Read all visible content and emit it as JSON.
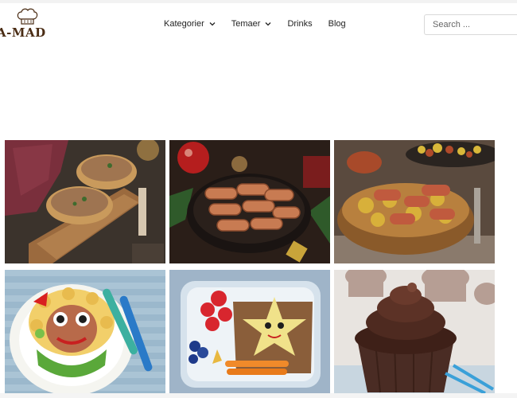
{
  "logo": {
    "text": "A-MAD",
    "icon": "chef-hat-icon"
  },
  "nav": {
    "items": [
      {
        "label": "Kategorier",
        "has_dropdown": true
      },
      {
        "label": "Temaer",
        "has_dropdown": true
      },
      {
        "label": "Drinks",
        "has_dropdown": false
      },
      {
        "label": "Blog",
        "has_dropdown": false
      }
    ]
  },
  "search": {
    "placeholder": "Search ..."
  },
  "grid": {
    "cards": [
      {
        "subject": "liver pâté on bread slices on wooden board"
      },
      {
        "subject": "sausages wrapped in bacon, Christmas setting"
      },
      {
        "subject": "sausages with roasted potatoes in wooden bowl"
      },
      {
        "subject": "pasta face plate for kids"
      },
      {
        "subject": "kids lunch box with star sandwich"
      },
      {
        "subject": "chocolate cupcake with frosting"
      }
    ]
  },
  "colors": {
    "brand": "#4a2c14",
    "nav_text": "#222222"
  }
}
